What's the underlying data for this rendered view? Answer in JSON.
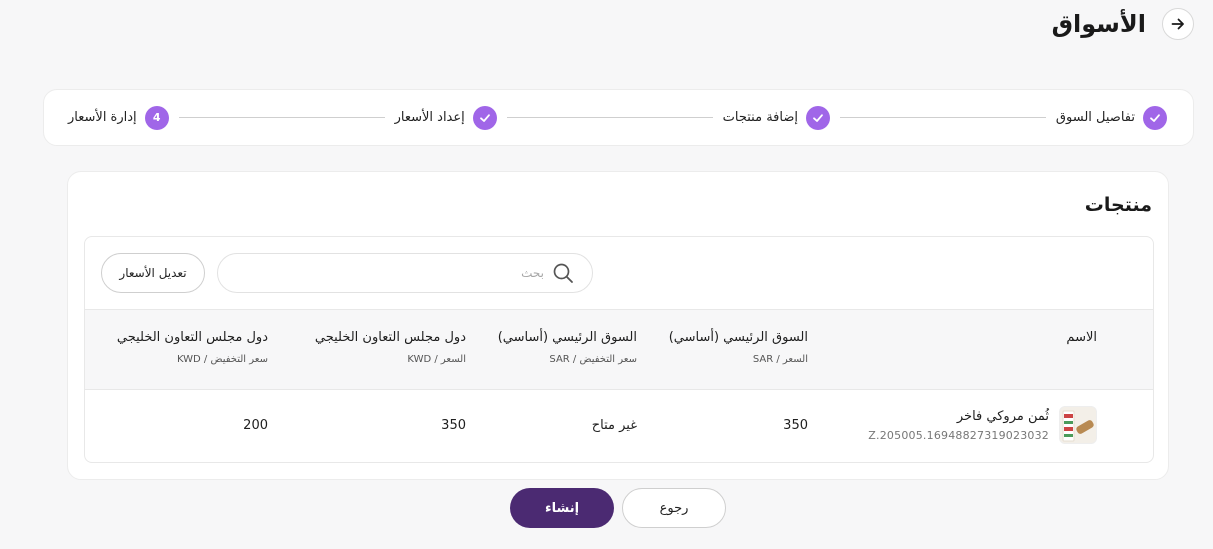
{
  "header": {
    "title": "الأسواق"
  },
  "stepper": {
    "steps": [
      {
        "label": "تفاصيل السوق",
        "state": "done"
      },
      {
        "label": "إضافة منتجات",
        "state": "done"
      },
      {
        "label": "إعداد الأسعار",
        "state": "done"
      },
      {
        "label": "إدارة الأسعار",
        "state": "active",
        "number": "4"
      }
    ]
  },
  "products": {
    "title": "منتجات",
    "search_placeholder": "بحث",
    "edit_prices_label": "تعديل الأسعار",
    "columns": [
      {
        "title": "الاسم",
        "subtitle": ""
      },
      {
        "title": "السوق الرئيسي (أساسي)",
        "subtitle": "السعر / SAR"
      },
      {
        "title": "السوق الرئيسي (أساسي)",
        "subtitle": "سعر التخفيض / SAR"
      },
      {
        "title": "دول مجلس التعاون الخليجي",
        "subtitle": "السعر / KWD"
      },
      {
        "title": "دول مجلس التعاون الخليجي",
        "subtitle": "سعر التخفيض / KWD"
      }
    ],
    "rows": [
      {
        "name": "ثُمن مروكي فاخر",
        "sku": "Z.205005.16948827319023032",
        "main_price": "350",
        "main_discount": "غير متاح",
        "gcc_price": "350",
        "gcc_discount": "200"
      }
    ]
  },
  "footer": {
    "create_label": "إنشاء",
    "back_label": "رجوع"
  },
  "colors": {
    "accent": "#a066e8",
    "primary": "#4b2a72"
  }
}
